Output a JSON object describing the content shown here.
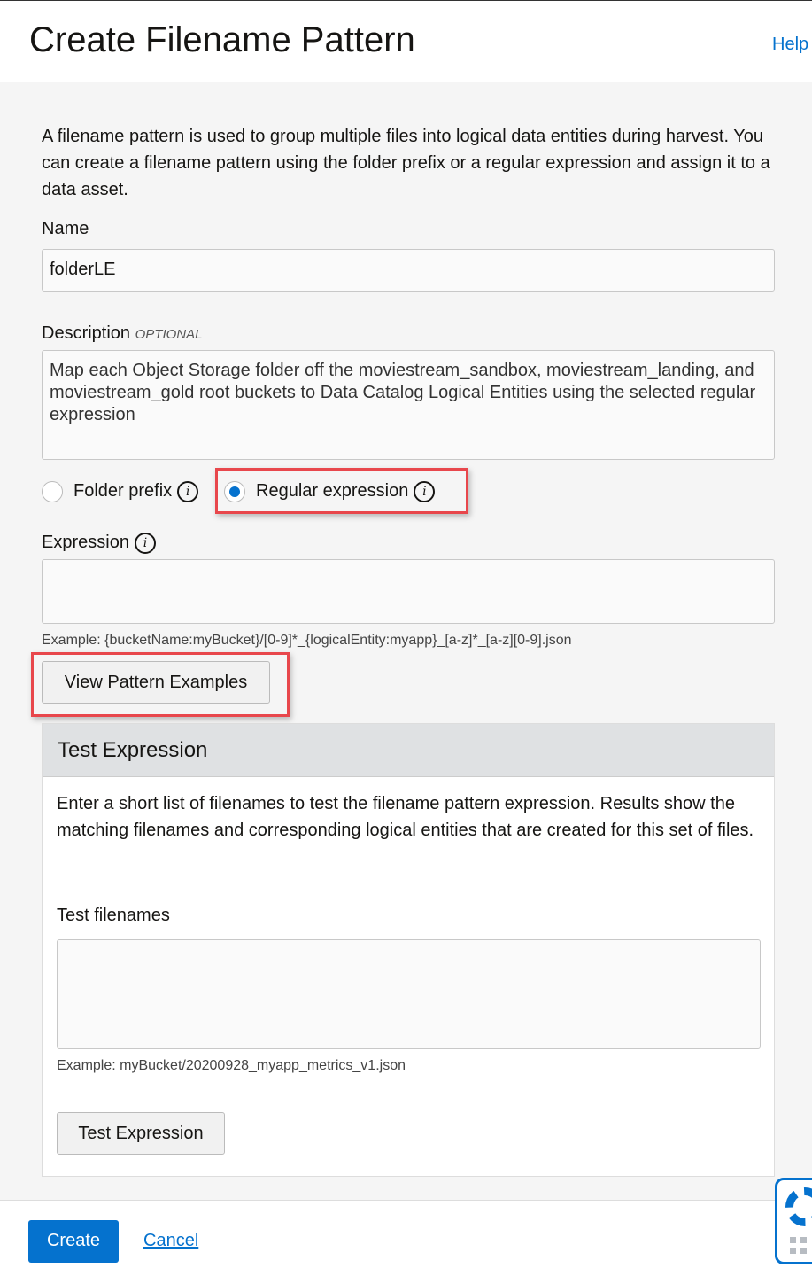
{
  "header": {
    "title": "Create Filename Pattern",
    "help": "Help"
  },
  "intro": "A filename pattern is used to group multiple files into logical data entities during harvest. You can create a filename pattern using the folder prefix or a regular expression and assign it to a data asset.",
  "name": {
    "label": "Name",
    "value": "folderLE"
  },
  "description": {
    "label": "Description",
    "optional": "OPTIONAL",
    "value": "Map each Object Storage folder off the moviestream_sandbox, moviestream_landing, and moviestream_gold root buckets to Data Catalog Logical Entities using the selected regular expression"
  },
  "pattern_type": {
    "options": [
      "Folder prefix",
      "Regular expression"
    ],
    "selected": "Regular expression"
  },
  "expression": {
    "label": "Expression",
    "value": "",
    "example": "Example: {bucketName:myBucket}/[0-9]*_{logicalEntity:myapp}_[a-z]*_[a-z][0-9].json"
  },
  "view_examples": "View Pattern Examples",
  "test": {
    "title": "Test Expression",
    "desc": "Enter a short list of filenames to test the filename pattern expression. Results show the matching filenames and corresponding logical entities that are created for this set of files.",
    "filenames_label": "Test filenames",
    "example": "Example: myBucket/20200928_myapp_metrics_v1.json",
    "button": "Test Expression"
  },
  "footer": {
    "create": "Create",
    "cancel": "Cancel"
  },
  "colors": {
    "accent": "#0572ce",
    "highlight": "#e8474c"
  }
}
